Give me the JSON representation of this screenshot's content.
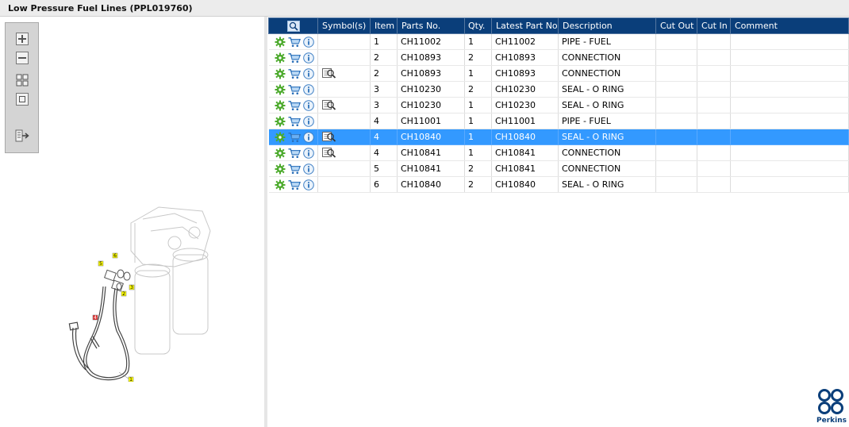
{
  "window": {
    "title": "Low Pressure Fuel Lines (PPL019760)"
  },
  "toolbox": {
    "tools": [
      {
        "name": "zoom-in-icon"
      },
      {
        "name": "zoom-out-icon"
      },
      {
        "name": "fit-view-icon"
      },
      {
        "name": "actual-size-icon"
      },
      {
        "name": "export-icon"
      }
    ]
  },
  "diagram": {
    "callouts": [
      "1",
      "2",
      "3",
      "4",
      "5",
      "6"
    ],
    "highlighted_callout": "4"
  },
  "table": {
    "columns": [
      "",
      "Symbol(s)",
      "Item",
      "Parts No.",
      "Qty.",
      "Latest Part No.",
      "Description",
      "Cut Out",
      "Cut In",
      "Comment"
    ],
    "rows": [
      {
        "symbol": false,
        "item": "1",
        "part_no": "CH11002",
        "qty": "1",
        "latest": "CH11002",
        "desc": "PIPE - FUEL",
        "cut_out": "",
        "cut_in": "",
        "comment": "",
        "selected": false
      },
      {
        "symbol": false,
        "item": "2",
        "part_no": "CH10893",
        "qty": "2",
        "latest": "CH10893",
        "desc": "CONNECTION",
        "cut_out": "",
        "cut_in": "",
        "comment": "",
        "selected": false
      },
      {
        "symbol": true,
        "item": "2",
        "part_no": "CH10893",
        "qty": "1",
        "latest": "CH10893",
        "desc": "CONNECTION",
        "cut_out": "",
        "cut_in": "",
        "comment": "",
        "selected": false
      },
      {
        "symbol": false,
        "item": "3",
        "part_no": "CH10230",
        "qty": "2",
        "latest": "CH10230",
        "desc": "SEAL - O RING",
        "cut_out": "",
        "cut_in": "",
        "comment": "",
        "selected": false
      },
      {
        "symbol": true,
        "item": "3",
        "part_no": "CH10230",
        "qty": "1",
        "latest": "CH10230",
        "desc": "SEAL - O RING",
        "cut_out": "",
        "cut_in": "",
        "comment": "",
        "selected": false
      },
      {
        "symbol": false,
        "item": "4",
        "part_no": "CH11001",
        "qty": "1",
        "latest": "CH11001",
        "desc": "PIPE - FUEL",
        "cut_out": "",
        "cut_in": "",
        "comment": "",
        "selected": false
      },
      {
        "symbol": true,
        "item": "4",
        "part_no": "CH10840",
        "qty": "1",
        "latest": "CH10840",
        "desc": "SEAL - O RING",
        "cut_out": "",
        "cut_in": "",
        "comment": "",
        "selected": true
      },
      {
        "symbol": true,
        "item": "4",
        "part_no": "CH10841",
        "qty": "1",
        "latest": "CH10841",
        "desc": "CONNECTION",
        "cut_out": "",
        "cut_in": "",
        "comment": "",
        "selected": false
      },
      {
        "symbol": false,
        "item": "5",
        "part_no": "CH10841",
        "qty": "2",
        "latest": "CH10841",
        "desc": "CONNECTION",
        "cut_out": "",
        "cut_in": "",
        "comment": "",
        "selected": false
      },
      {
        "symbol": false,
        "item": "6",
        "part_no": "CH10840",
        "qty": "2",
        "latest": "CH10840",
        "desc": "SEAL - O RING",
        "cut_out": "",
        "cut_in": "",
        "comment": "",
        "selected": false
      }
    ]
  },
  "brand": {
    "name": "Perkins",
    "color": "#0a3e7a"
  },
  "colors": {
    "header": "#0a3e7a",
    "selected_row": "#3399ff",
    "callout": "#ffff00",
    "callout_highlight": "#e03030"
  }
}
